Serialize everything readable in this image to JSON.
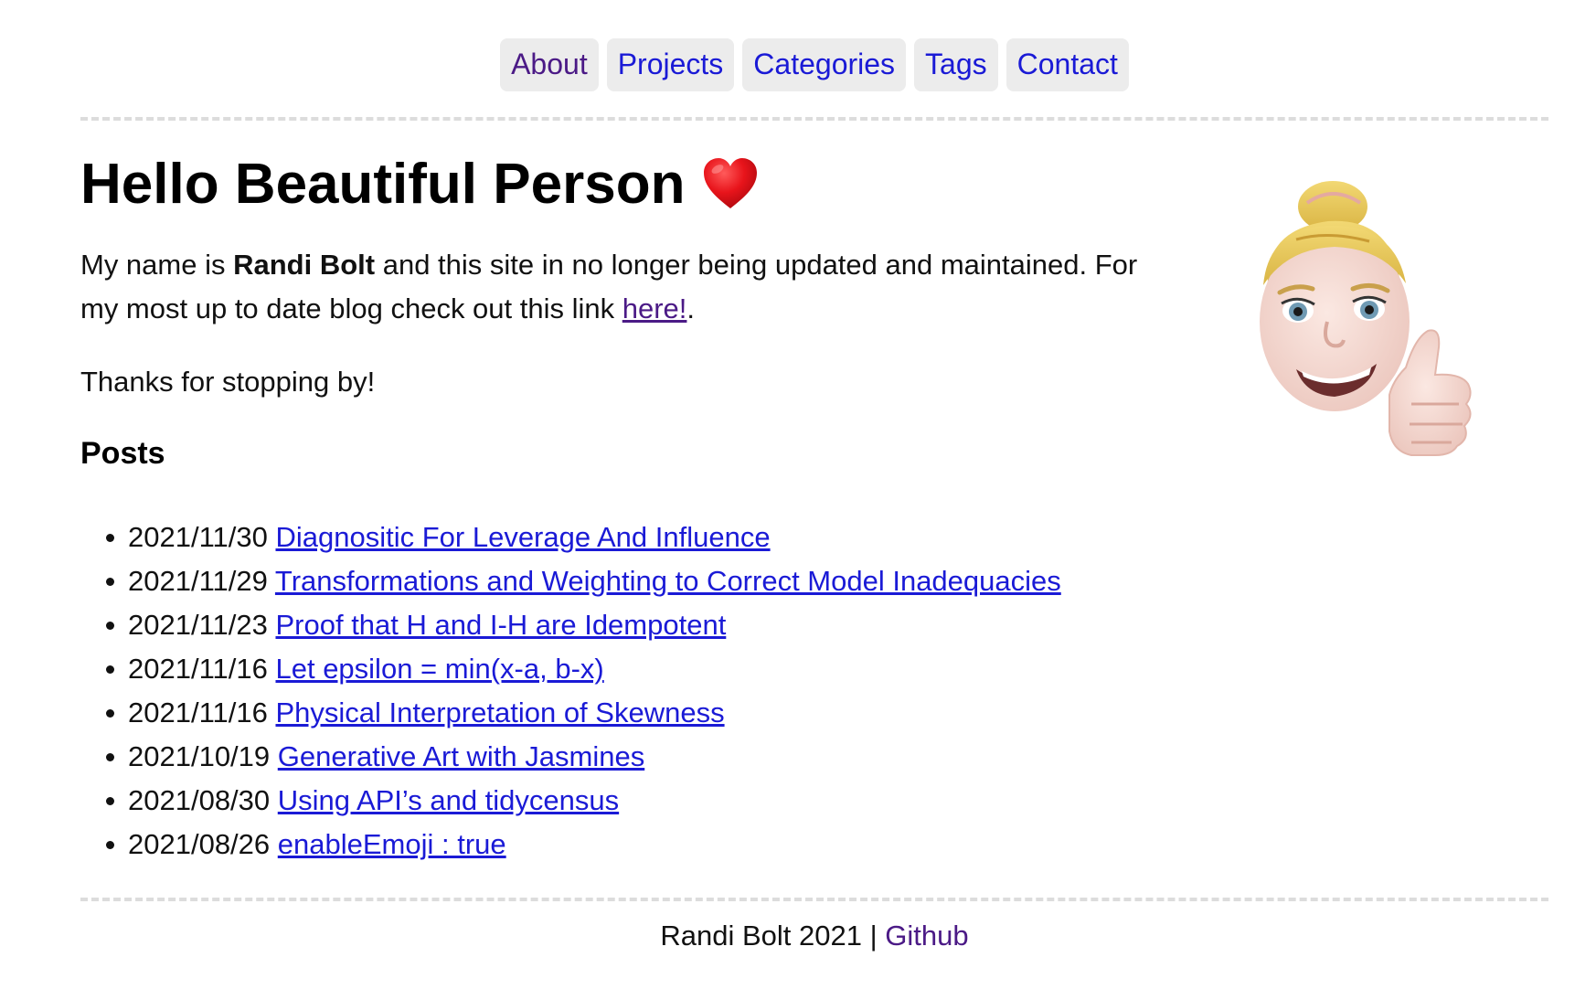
{
  "nav": {
    "items": [
      {
        "label": "About"
      },
      {
        "label": "Projects"
      },
      {
        "label": "Categories"
      },
      {
        "label": "Tags"
      },
      {
        "label": "Contact"
      }
    ]
  },
  "main": {
    "heading": "Hello Beautiful Person",
    "heading_emoji": "heart-icon",
    "intro_prefix": "My name is ",
    "intro_name": "Randi Bolt",
    "intro_mid": " and this site in no longer being updated and maintained. For my most up to date blog check out this link ",
    "intro_link": "here!",
    "intro_suffix": ".",
    "thanks": "Thanks for stopping by!",
    "posts_heading": "Posts",
    "avatar": "memoji-thumbs-up-avatar"
  },
  "posts": [
    {
      "date": "2021/11/30",
      "title": "Diagnositic For Leverage And Influence"
    },
    {
      "date": "2021/11/29",
      "title": "Transformations and Weighting to Correct Model Inadequacies"
    },
    {
      "date": "2021/11/23",
      "title": "Proof that H and I-H are Idempotent"
    },
    {
      "date": "2021/11/16",
      "title": "Let epsilon = min(x-a, b-x)"
    },
    {
      "date": "2021/11/16",
      "title": "Physical Interpretation of Skewness"
    },
    {
      "date": "2021/10/19",
      "title": "Generative Art with Jasmines"
    },
    {
      "date": "2021/08/30",
      "title": "Using API’s and tidycensus"
    },
    {
      "date": "2021/08/26",
      "title": "enableEmoji : true"
    }
  ],
  "footer": {
    "text": "Randi Bolt 2021 | ",
    "link": "Github"
  },
  "colors": {
    "link": "#1a1ad6",
    "visited": "#4b1a86",
    "nav_bg": "#ececec",
    "rule": "#dcdcdc"
  }
}
